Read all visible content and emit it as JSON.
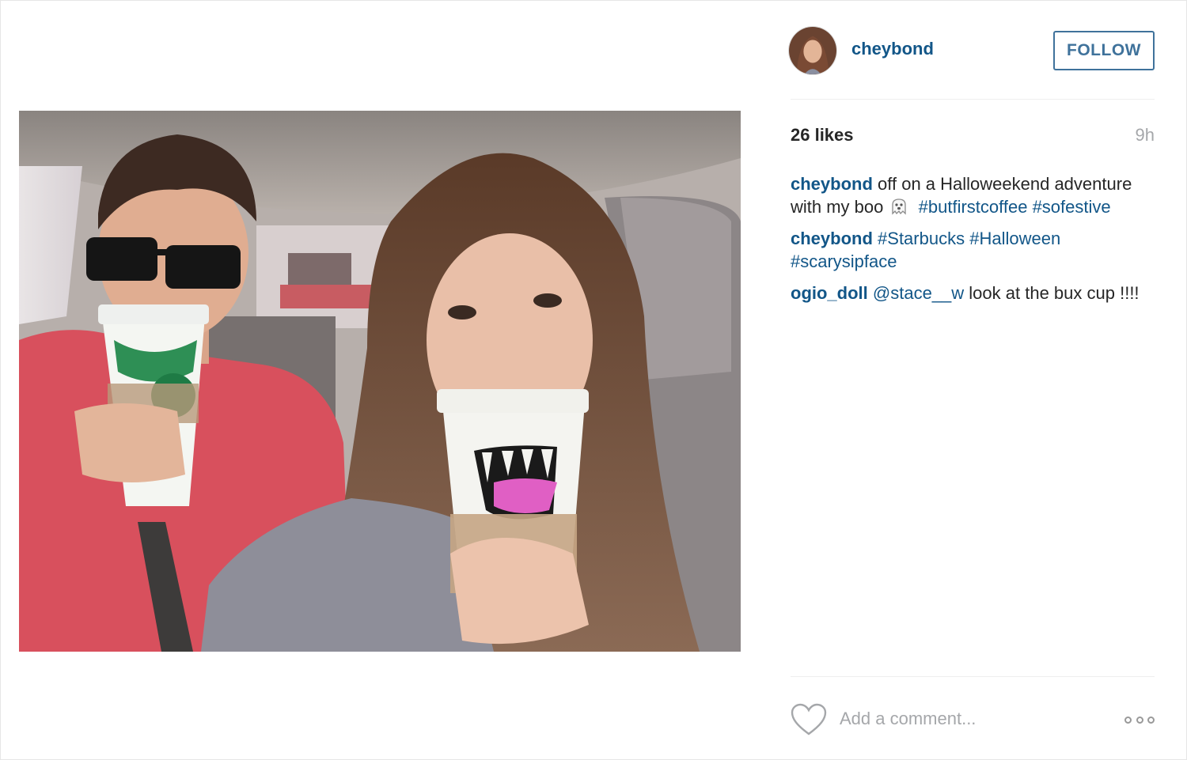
{
  "post": {
    "username": "cheybond",
    "follow_label": "FOLLOW",
    "likes": "26 likes",
    "time_ago": "9h"
  },
  "comments": [
    {
      "author": "cheybond",
      "text_before": "off on a Halloweekend adventure with my boo",
      "emoji": "ghost-icon",
      "tags": [
        "#butfirstcoffee",
        "#sofestive"
      ]
    },
    {
      "author": "cheybond",
      "tags": [
        "#Starbucks",
        "#Halloween",
        "#scarysipface"
      ]
    },
    {
      "author": "ogio_doll",
      "mention": "@stace__w",
      "text_after": "look at the bux cup !!!!"
    }
  ],
  "footer": {
    "comment_placeholder": "Add a comment..."
  },
  "colors": {
    "link": "#125688",
    "follow_border": "#3f729b",
    "muted": "#a5a7aa"
  }
}
